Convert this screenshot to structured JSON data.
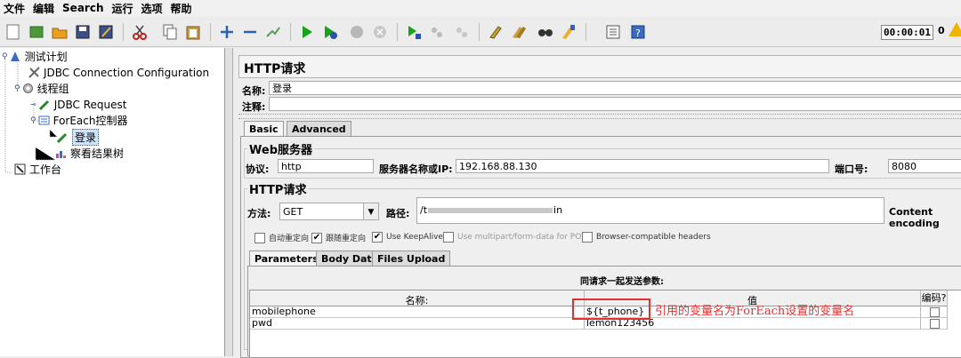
{
  "menu": [
    "文件",
    "编辑",
    "Search",
    "运行",
    "选项",
    "帮助"
  ],
  "toolbar": {
    "timer": "00:00:01",
    "warn_count": "0"
  },
  "tree": {
    "test_plan": "测试计划",
    "jdbc_config": "JDBC Connection Configuration",
    "thread_group": "线程组",
    "jdbc_request": "JDBC Request",
    "foreach": "ForEach控制器",
    "login": "登录",
    "results_tree": "察看结果树",
    "workbench": "工作台"
  },
  "panel": {
    "title": "HTTP请求",
    "name_label": "名称:",
    "name_value": "登录",
    "comment_label": "注释:",
    "tab_basic": "Basic",
    "tab_advanced": "Advanced",
    "web_server": "Web服务器",
    "protocol_label": "协议:",
    "protocol_value": "http",
    "server_label": "服务器名称或IP:",
    "server_value": "192.168.88.130",
    "port_label": "端口号:",
    "port_value": "8080",
    "http_request": "HTTP请求",
    "method_label": "方法:",
    "method_value": "GET",
    "path_label": "路径:",
    "path_value": "/t",
    "path_suffix": "in",
    "content_encoding": "Content encoding",
    "options": {
      "auto_redirect": "自动重定向",
      "follow_redirect": "跟随重定向",
      "keepalive": "Use KeepAlive",
      "multipart": "Use multipart/form-data for POST",
      "browser_headers": "Browser-compatible headers"
    },
    "subtab_parameters": "Parameters",
    "subtab_body": "Body Data",
    "subtab_files": "Files Upload",
    "send_params": "同请求一起发送参数:",
    "col_name": "名称:",
    "col_value": "值",
    "col_encode": "编码?",
    "rows": [
      {
        "name": "mobilephone",
        "value": "${t_phone}"
      },
      {
        "name": "pwd",
        "value": "lemon123456"
      }
    ]
  },
  "annotation": "引用的变量名为ForEach设置的变量名",
  "colors": {
    "annotation": "#e03030",
    "run_green": "#1aa31a"
  }
}
